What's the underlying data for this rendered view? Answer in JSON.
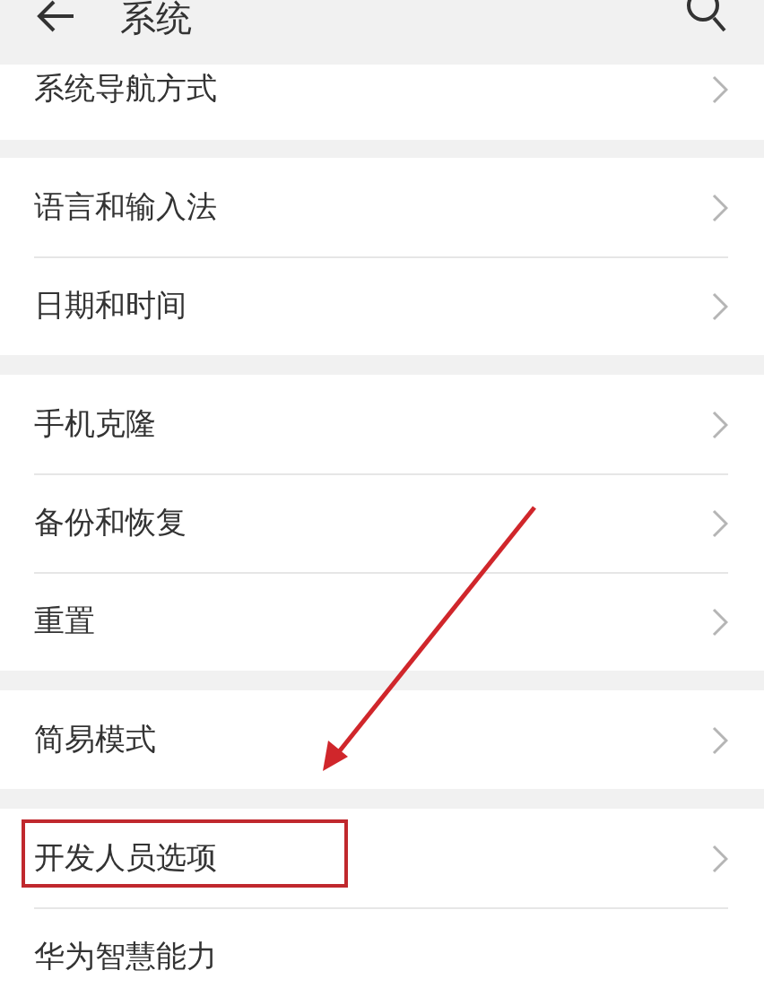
{
  "header": {
    "title": "系统"
  },
  "groups": [
    {
      "items": [
        {
          "label": "系统导航方式",
          "chevron": true,
          "highlighted": false
        }
      ]
    },
    {
      "items": [
        {
          "label": "语言和输入法",
          "chevron": true,
          "highlighted": false
        },
        {
          "label": "日期和时间",
          "chevron": true,
          "highlighted": false
        }
      ]
    },
    {
      "items": [
        {
          "label": "手机克隆",
          "chevron": true,
          "highlighted": false
        },
        {
          "label": "备份和恢复",
          "chevron": true,
          "highlighted": false
        },
        {
          "label": "重置",
          "chevron": true,
          "highlighted": false
        }
      ]
    },
    {
      "items": [
        {
          "label": "简易模式",
          "chevron": true,
          "highlighted": false
        }
      ]
    },
    {
      "items": [
        {
          "label": "开发人员选项",
          "chevron": true,
          "highlighted": true
        },
        {
          "label": "华为智慧能力",
          "chevron": false,
          "highlighted": false
        }
      ]
    }
  ]
}
